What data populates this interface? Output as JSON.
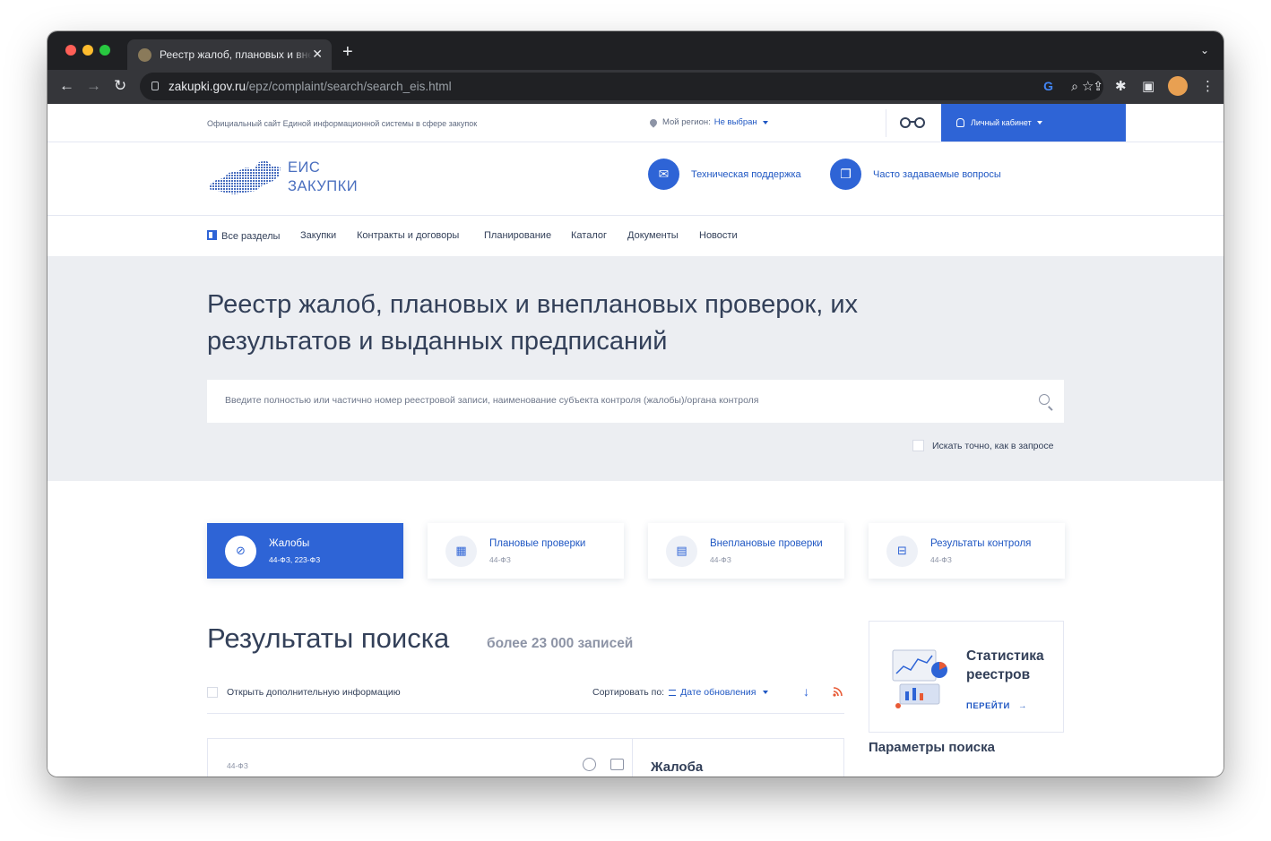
{
  "browser": {
    "tab_title": "Реестр жалоб, плановых и внеплановых проверок",
    "url_domain": "zakupki.gov.ru",
    "url_path": "/epz/complaint/search/search_eis.html"
  },
  "topbar": {
    "official": "Официальный сайт Единой информационной системы в сфере закупок",
    "region_label": "Мой регион:",
    "region_value": "Не выбран",
    "cabinet": "Личный кабинет"
  },
  "header": {
    "logo_line1": "ЕИС",
    "logo_line2": "ЗАКУПКИ",
    "support": "Техническая поддержка",
    "faq": "Часто задаваемые вопросы"
  },
  "menu": [
    "Все разделы",
    "Закупки",
    "Контракты и договоры",
    "Планирование",
    "Каталог",
    "Документы",
    "Новости"
  ],
  "hero": {
    "title": "Реестр жалоб, плановых и внеплановых проверок, их результатов и выданных предписаний",
    "search_placeholder": "Введите полностью или частично номер реестровой записи, наименование субъекта контроля (жалобы)/органа контроля",
    "exact_label": "Искать точно, как в запросе"
  },
  "cards": [
    {
      "title": "Жалобы",
      "sub": "44-ФЗ, 223-ФЗ",
      "icon": "complaint-icon"
    },
    {
      "title": "Плановые проверки",
      "sub": "44-ФЗ",
      "icon": "calendar-icon"
    },
    {
      "title": "Внеплановые проверки",
      "sub": "44-ФЗ",
      "icon": "document-icon"
    },
    {
      "title": "Результаты контроля",
      "sub": "44-ФЗ",
      "icon": "briefcase-icon"
    }
  ],
  "results": {
    "title": "Результаты поиска",
    "count": "более 23 000 записей",
    "open_more": "Открыть дополнительную информацию",
    "sort_label": "Сортировать по:",
    "sort_value": "Дате обновления"
  },
  "entry": {
    "law": "44-ФЗ",
    "kind": "Жалоба"
  },
  "stats": {
    "title_line1": "Статистика",
    "title_line2": "реестров",
    "go": "ПЕРЕЙТИ"
  },
  "params_title": "Параметры поиска",
  "colors": {
    "accent": "#2e64d6",
    "link": "#1f57c3",
    "text": "#334059",
    "muted": "#8d94a6",
    "hero_bg": "#eceef2"
  }
}
